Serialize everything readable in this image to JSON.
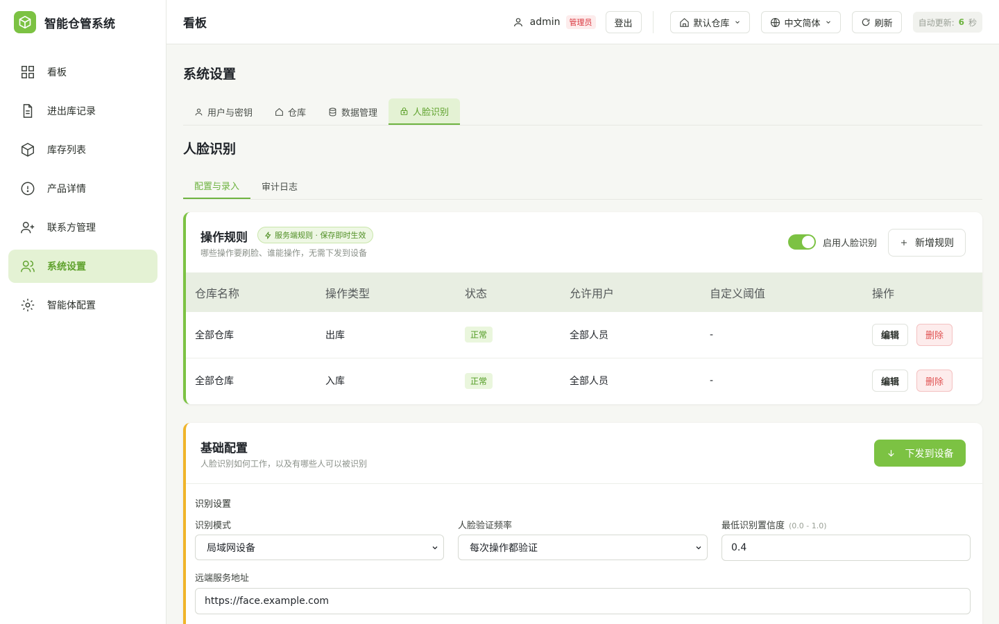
{
  "brand": {
    "title": "智能仓管系统"
  },
  "sidebar": {
    "items": [
      {
        "label": "看板"
      },
      {
        "label": "进出库记录"
      },
      {
        "label": "库存列表"
      },
      {
        "label": "产品详情"
      },
      {
        "label": "联系方管理"
      },
      {
        "label": "系统设置"
      },
      {
        "label": "智能体配置"
      }
    ]
  },
  "header": {
    "title": "看板",
    "user": "admin",
    "role": "管理员",
    "logout": "登出",
    "warehouse": "默认仓库",
    "language": "中文简体",
    "refresh": "刷新",
    "auto_label": "自动更新:",
    "auto_value": "6",
    "auto_unit": "秒"
  },
  "page": {
    "title": "系统设置",
    "tabs": [
      {
        "label": "用户与密钥"
      },
      {
        "label": "仓库"
      },
      {
        "label": "数据管理"
      },
      {
        "label": "人脸识别"
      }
    ],
    "section_title": "人脸识别",
    "subtabs": [
      {
        "label": "配置与录入"
      },
      {
        "label": "审计日志"
      }
    ]
  },
  "rules": {
    "title": "操作规则",
    "tag": "服务端规则 · 保存即时生效",
    "desc": "哪些操作要刷脸、谁能操作，无需下发到设备",
    "toggle_label": "启用人脸识别",
    "toggle_on": true,
    "add_label": "新增规则",
    "columns": [
      "仓库名称",
      "操作类型",
      "状态",
      "允许用户",
      "自定义阈值",
      "操作"
    ],
    "rows": [
      {
        "warehouse": "全部仓库",
        "type": "出库",
        "status": "正常",
        "users": "全部人员",
        "threshold": "-",
        "edit": "编辑",
        "delete": "删除"
      },
      {
        "warehouse": "全部仓库",
        "type": "入库",
        "status": "正常",
        "users": "全部人员",
        "threshold": "-",
        "edit": "编辑",
        "delete": "删除"
      }
    ]
  },
  "basic": {
    "title": "基础配置",
    "desc": "人脸识别如何工作，以及有哪些人可以被识别",
    "dispatch": "下发到设备",
    "group_title": "识别设置",
    "mode_label": "识别模式",
    "mode_value": "局域网设备",
    "freq_label": "人脸验证频率",
    "freq_value": "每次操作都验证",
    "conf_label": "最低识别置信度",
    "conf_hint": "(0.0 - 1.0)",
    "conf_value": "0.4",
    "remote_label": "远端服务地址",
    "remote_value": "https://face.example.com"
  },
  "colors": {
    "accent": "#7cc243",
    "accent_bg": "#e4f2d4",
    "danger": "#e05252",
    "warning": "#f0b429"
  }
}
